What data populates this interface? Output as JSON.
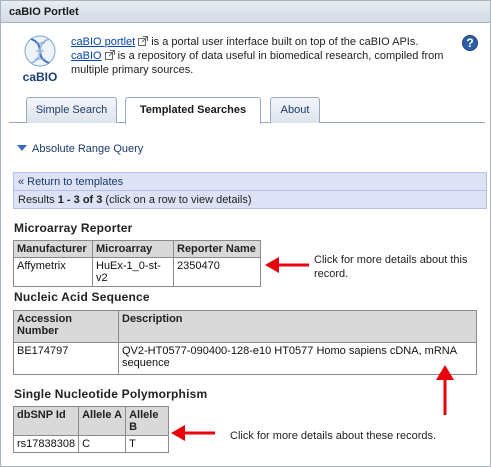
{
  "window": {
    "title": "caBIO Portlet"
  },
  "logo": {
    "text": "caBIO"
  },
  "intro": {
    "link1": "caBIO portlet",
    "text1": "is a portal user interface built on top of the caBIO APIs.",
    "link2": "caBIO",
    "text2": "is a repository of data useful in biomedical research, compiled from multiple primary sources."
  },
  "help": {
    "label": "?"
  },
  "tabs": [
    {
      "label": "Simple Search"
    },
    {
      "label": "Templated Searches"
    },
    {
      "label": "About"
    }
  ],
  "query": {
    "label": "Absolute Range Query"
  },
  "nav": {
    "back": "« Return to templates",
    "results_prefix": "Results ",
    "results_range": "1 - 3 of 3",
    "results_suffix": " (click on a row to view details)"
  },
  "sections": {
    "microarray": {
      "title": "Microarray Reporter",
      "headers": [
        "Manufacturer",
        "Microarray",
        "Reporter Name"
      ],
      "rows": [
        [
          "Affymetrix",
          "HuEx-1_0-st-v2",
          "2350470"
        ]
      ]
    },
    "nucleic": {
      "title": "Nucleic Acid Sequence",
      "headers": [
        "Accession Number",
        "Description"
      ],
      "rows": [
        [
          "BE174797",
          "QV2-HT0577-090400-128-e10 HT0577 Homo sapiens cDNA, mRNA sequence"
        ]
      ]
    },
    "snp": {
      "title": "Single Nucleotide Polymorphism",
      "headers": [
        "dbSNP Id",
        "Allele A",
        "Allele B"
      ],
      "rows": [
        [
          "rs17838308",
          "C",
          "T"
        ]
      ]
    }
  },
  "annotations": {
    "record_note": "Click for more details about this record.",
    "records_note": "Click for more details about these records."
  },
  "colors": {
    "arrow": "#e8000b",
    "link": "#0645ad",
    "nav_bg": "#dde2f7"
  }
}
